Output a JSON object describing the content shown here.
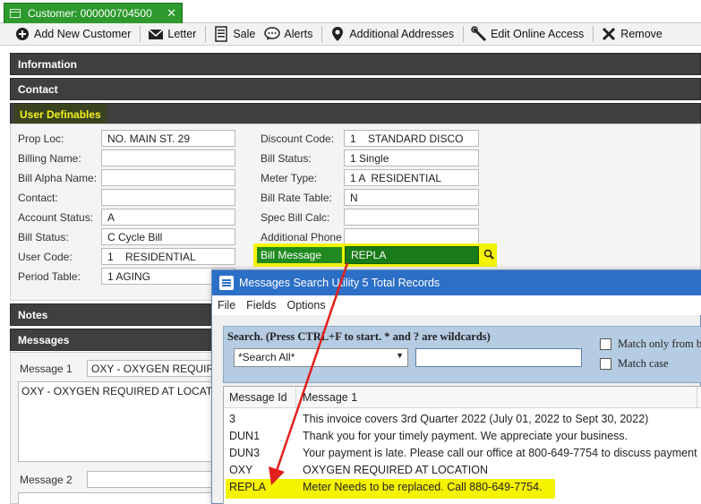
{
  "tab": {
    "title": "Customer: 000000704500",
    "close_glyph": "✕"
  },
  "toolbar": {
    "add_new_customer": "Add New Customer",
    "letter": "Letter",
    "sale": "Sale",
    "alerts": "Alerts",
    "additional_addresses": "Additional Addresses",
    "edit_online_access": "Edit Online Access",
    "remove": "Remove"
  },
  "sections": {
    "information": "Information",
    "contact": "Contact",
    "user_definables": "User Definables",
    "notes": "Notes",
    "messages": "Messages"
  },
  "fields_left": [
    {
      "label": "Prop Loc:",
      "value": "NO. MAIN ST. 29"
    },
    {
      "label": "Billing Name:",
      "value": ""
    },
    {
      "label": "Bill Alpha Name:",
      "value": ""
    },
    {
      "label": "Contact:",
      "value": ""
    },
    {
      "label": "Account Status:",
      "value": "A"
    },
    {
      "label": "Bill Status:",
      "value": "C Cycle Bill"
    },
    {
      "label": "User Code:",
      "value": "1    RESIDENTIAL"
    },
    {
      "label": "Period Table:",
      "value": "1 AGING"
    }
  ],
  "fields_right": [
    {
      "label": "Discount Code:",
      "value": "1    STANDARD DISCO"
    },
    {
      "label": "Bill Status:",
      "value": "1 Single"
    },
    {
      "label": "Meter Type:",
      "value": "1 A  RESIDENTIAL"
    },
    {
      "label": "Bill Rate Table:",
      "value": "N"
    },
    {
      "label": "Spec Bill Calc:",
      "value": ""
    },
    {
      "label": "Additional Phone",
      "value": ""
    }
  ],
  "bill_message": {
    "label": "Bill Message",
    "value": "REPLA"
  },
  "messages_panel": {
    "message1_label": "Message 1",
    "message1_select": "OXY - OXYGEN REQUIRED AT LOCATION",
    "message1_text": "OXY - OXYGEN REQUIRED AT LOCATION",
    "message2_label": "Message 2",
    "message2_select": ""
  },
  "popup": {
    "title": "Messages Search Utility 5 Total Records",
    "menu": [
      "File",
      "Fields",
      "Options"
    ],
    "search_title": "Search.  (Press CTRL+F to start.  * and ? are wildcards)",
    "search_select": "*Search All*",
    "search_value": "",
    "match_only_from_beginning": "Match only from be",
    "match_case": "Match case",
    "columns": [
      "Message Id",
      "Message 1"
    ],
    "rows": [
      {
        "id": "3",
        "message": "This invoice covers 3rd Quarter 2022 (July 01, 2022 to Sept 30, 2022)"
      },
      {
        "id": "DUN1",
        "message": "Thank you for your timely payment.  We appreciate your business."
      },
      {
        "id": "DUN3",
        "message": "Your payment is late.  Please call our office at 800-649-7754 to discuss payment"
      },
      {
        "id": "OXY",
        "message": "OXYGEN REQUIRED AT LOCATION"
      },
      {
        "id": "REPLA",
        "message": "Meter Needs to be replaced.  Call 880-649-7754."
      }
    ]
  },
  "colors": {
    "tab_green": "#2e9a2e",
    "section_dark": "#3f3f3f",
    "highlight_yellow": "#f6f300",
    "bill_message_green": "#187a18",
    "popup_title_blue": "#2c6fc6",
    "search_panel_blue": "#b5cce3",
    "annotation_arrow_red": "#e0201c"
  },
  "icons": [
    "list-icon",
    "close-icon",
    "add-icon",
    "envelope-icon",
    "receipt-icon",
    "speech-bubble-icon",
    "map-pin-icon",
    "wrench-icon",
    "x-icon",
    "magnifier-icon",
    "app-icon"
  ]
}
